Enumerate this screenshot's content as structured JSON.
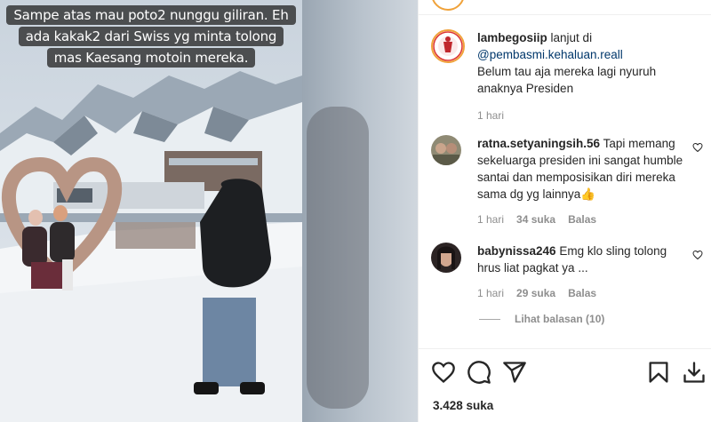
{
  "media": {
    "caption_lines": [
      "Sampe atas mau poto2 nunggu giliran. Eh",
      "ada kakak2 dari Swiss yg minta tolong",
      "mas Kaesang motoin mereka."
    ]
  },
  "post": {
    "author": "lambegosiip",
    "text_before": "lanjut di",
    "mention": "@pembasmi.kehaluan.reall",
    "text_after": "Belum tau aja mereka lagi nyuruh anaknya Presiden",
    "time": "1 hari"
  },
  "comments": [
    {
      "user": "ratna.setyaningsih.56",
      "text": "Tapi memang sekeluarga presiden ini sangat humble santai dan memposisikan diri mereka sama dg yg lainnya👍",
      "time": "1 hari",
      "likes": "34 suka",
      "reply": "Balas"
    },
    {
      "user": "babynissa246",
      "text": "Emg klo sling tolong hrus liat pagkat ya ...",
      "time": "1 hari",
      "likes": "29 suka",
      "reply": "Balas"
    }
  ],
  "view_replies": "Lihat balasan (10)",
  "likes_total": "3.428 suka",
  "icons": {
    "like": "heart-icon",
    "comment": "comment-icon",
    "share": "paper-plane-icon",
    "save": "bookmark-icon",
    "download": "download-icon"
  },
  "colors": {
    "mention": "#00376b",
    "meta": "#8e8e8e",
    "story_ring": "#f0a23a"
  }
}
